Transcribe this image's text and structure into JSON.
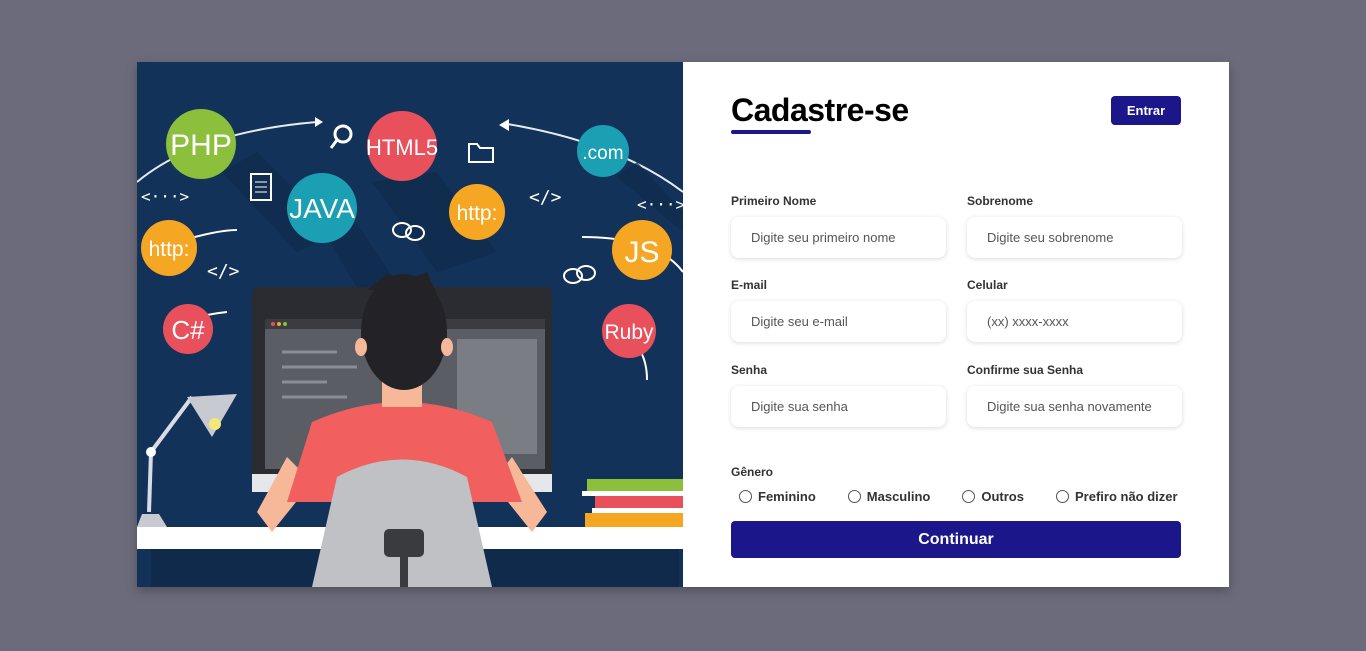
{
  "header": {
    "title": "Cadastre-se",
    "login_label": "Entrar"
  },
  "fields": {
    "first_name": {
      "label": "Primeiro Nome",
      "placeholder": "Digite seu primeiro nome"
    },
    "last_name": {
      "label": "Sobrenome",
      "placeholder": "Digite seu sobrenome"
    },
    "email": {
      "label": "E-mail",
      "placeholder": "Digite seu e-mail"
    },
    "phone": {
      "label": "Celular",
      "placeholder": "(xx) xxxx-xxxx"
    },
    "password": {
      "label": "Senha",
      "placeholder": "Digite sua senha"
    },
    "confirm_password": {
      "label": "Confirme sua Senha",
      "placeholder": "Digite sua senha novamente"
    }
  },
  "gender": {
    "title": "Gênero",
    "options": [
      "Feminino",
      "Masculino",
      "Outros",
      "Prefiro não dizer"
    ]
  },
  "continue_label": "Continuar",
  "illustration": {
    "badges": [
      "PHP",
      "HTML5",
      ".com",
      "JAVA",
      "http:",
      "http:",
      "JS",
      "C#",
      "Ruby"
    ],
    "code_glyphs": [
      "<···>",
      "</>",
      "</>",
      "<···>"
    ]
  },
  "colors": {
    "background": "#6c6b7b",
    "accent": "#1b1689",
    "illustration_bg": "#133259",
    "php": "#8bbf3c",
    "html5": "#e8505b",
    "com": "#1b9fb3",
    "java": "#1b9fb3",
    "http": "#f5a623",
    "js": "#f5a623",
    "csharp": "#e8505b",
    "ruby": "#e8505b"
  }
}
